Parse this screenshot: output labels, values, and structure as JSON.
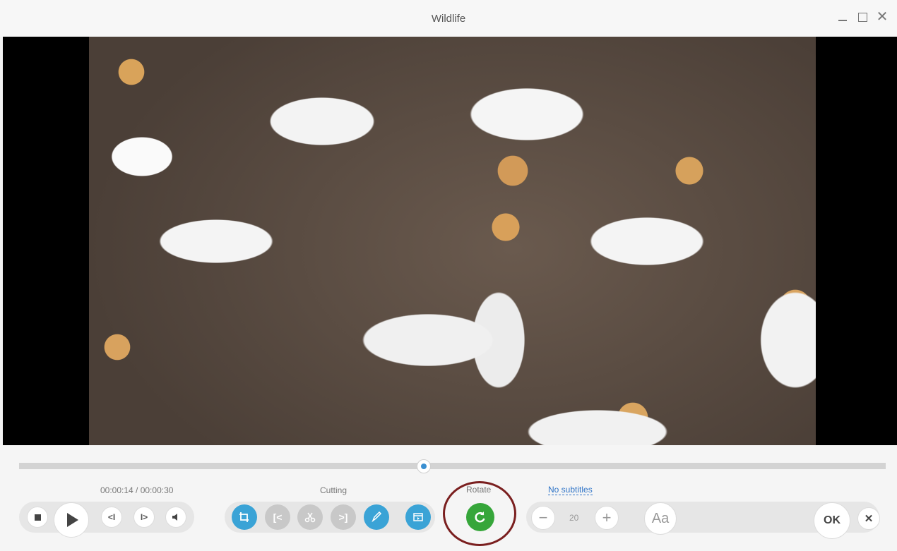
{
  "window": {
    "title": "Wildlife",
    "minimize_icon": "minimize-icon",
    "maximize_icon": "maximize-icon",
    "close_glyph": "✕"
  },
  "player": {
    "progress_fraction": 0.467,
    "time_display": "00:00:14 / 00:00:30",
    "prev_frame_label": "<I",
    "next_frame_label": "I>"
  },
  "sections": {
    "cutting": "Cutting",
    "rotate": "Rotate",
    "subtitles": "No subtitles"
  },
  "cutting_buttons": [
    {
      "icon": "crop-icon"
    },
    {
      "icon": "set-start-icon",
      "label": "[<"
    },
    {
      "icon": "scissors-icon"
    },
    {
      "icon": "set-end-icon",
      "label": ">]"
    },
    {
      "icon": "edit-icon"
    },
    {
      "icon": "clip-icon"
    }
  ],
  "rotate_icon": "rotate-icon",
  "subtitle_controls": {
    "minus": "−",
    "size": "20",
    "plus": "+",
    "font": "Aa"
  },
  "actions": {
    "ok": "OK",
    "cancel": "✕"
  },
  "colors": {
    "accent_blue": "#3aa3d6",
    "rotate_green": "#36a63a",
    "highlight_ring": "#7a1f1f",
    "link_blue": "#2f74c7"
  }
}
